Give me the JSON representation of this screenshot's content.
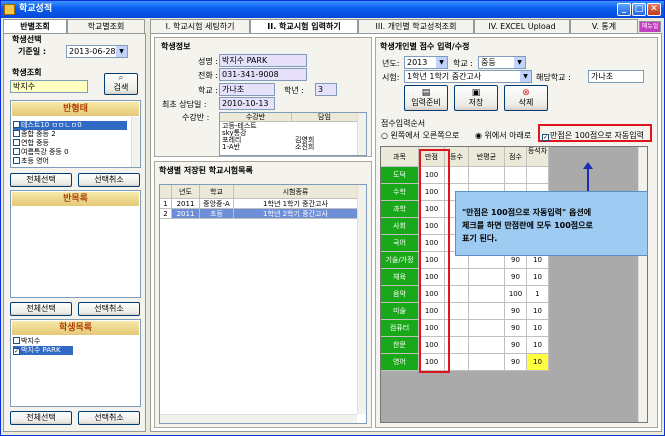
{
  "window": {
    "title": "학교성적",
    "minimize": "_",
    "maximize": "□",
    "close": "✕"
  },
  "left_tabs": [
    {
      "label": "반별조회"
    },
    {
      "label": "학교별조회"
    }
  ],
  "left": {
    "student_select": "학생선택",
    "base_date_label": "기준일 :",
    "base_date": "2013-06-28",
    "student_search": "학생조회",
    "search_value": "박지수",
    "search_button": "검색",
    "class_list": {
      "header": "반형태",
      "items": [
        {
          "label": "테스트10 ㅁㅁㄴㅁ0",
          "checked": false,
          "selected": true
        },
        {
          "label": "종합 중등 2",
          "checked": false,
          "selected": false
        },
        {
          "label": "연합 중등",
          "checked": false,
          "selected": false
        },
        {
          "label": "여름특강 중등 0",
          "checked": false,
          "selected": false
        },
        {
          "label": "초등 영어",
          "checked": false,
          "selected": false
        }
      ],
      "select_all": "전체선택",
      "deselect": "선택취소"
    },
    "class_items": {
      "header": "반목록",
      "select_all": "전체선택",
      "deselect": "선택취소"
    },
    "student_list": {
      "header": "학생목록",
      "items": [
        {
          "label": "박지수",
          "checked": false,
          "selected": false
        },
        {
          "label": "박지수 PARK",
          "checked": true,
          "selected": true
        }
      ],
      "select_all": "전체선택",
      "deselect": "선택취소"
    }
  },
  "main_tabs": [
    {
      "label": "I. 학교시험 세팅하기"
    },
    {
      "label": "II. 학교시험 입력하기"
    },
    {
      "label": "III. 개인별 학교성적조회"
    },
    {
      "label": "IV. EXCEL Upload"
    },
    {
      "label": "V. 통계"
    },
    {
      "label": "매뉴얼"
    }
  ],
  "student_info": {
    "title": "학생정보",
    "name_label": "성명 :",
    "name": "박지수 PARK",
    "phone_label": "전화 :",
    "phone": "031-341-9008",
    "school_label": "학교 :",
    "school": "가나초",
    "grade_label": "학년 :",
    "grade": "3",
    "consult_label": "최초 상담일 :",
    "consult_date": "2010-10-13",
    "classes_label": "수강반 :",
    "classes_header": [
      "수강반",
      "담임"
    ],
    "classes": [
      [
        "고등-테스트",
        ""
      ],
      [
        "sky통강",
        ""
      ],
      [
        "포레리",
        "김영희"
      ],
      [
        "1-A반",
        "소진희"
      ]
    ]
  },
  "saved_exams": {
    "title": "학생별 저장된 학교시험목록",
    "headers": [
      "",
      "년도",
      "학교",
      "시험종류"
    ],
    "rows": [
      [
        "1",
        "2011",
        "중앙중-A",
        "1학년 1학기 중간고사"
      ],
      [
        "2",
        "2011",
        "초등",
        "1학년 2학기 중간고사"
      ]
    ]
  },
  "score_entry": {
    "title": "학생개인별 점수 입력/수정",
    "year_label": "년도:",
    "year": "2013",
    "school_level_label": "학교 :",
    "school_level": "중등",
    "exam_label": "시험:",
    "exam": "1학년 1학기 중간고사",
    "school_label": "해당학교 :",
    "school": "가나초",
    "prepare_button": "입력준비",
    "save_button": "저장",
    "delete_button": "삭제",
    "order_label": "점수입력순서",
    "order_lr": "왼쪽에서 오른쪽으로",
    "order_tb": "위에서 아래로",
    "auto_max_label": "만점은 100점으로 자동입력",
    "headers": [
      "과목",
      "만점",
      "등수",
      "반평균",
      "점수",
      "등석차"
    ],
    "rows": [
      [
        "도덕",
        "100",
        "",
        "",
        "",
        ""
      ],
      [
        "수학",
        "100",
        "",
        "",
        "",
        ""
      ],
      [
        "과학",
        "100",
        "",
        "",
        "",
        ""
      ],
      [
        "사회",
        "100",
        "",
        "",
        "",
        ""
      ],
      [
        "국어",
        "100",
        "",
        "",
        "70",
        "10"
      ],
      [
        "기술/가정",
        "100",
        "",
        "",
        "90",
        "10"
      ],
      [
        "체육",
        "100",
        "",
        "",
        "90",
        "10"
      ],
      [
        "음악",
        "100",
        "",
        "",
        "100",
        "1"
      ],
      [
        "미술",
        "100",
        "",
        "",
        "90",
        "10"
      ],
      [
        "컴퓨터",
        "100",
        "",
        "",
        "90",
        "10"
      ],
      [
        "한문",
        "100",
        "",
        "",
        "90",
        "10"
      ],
      [
        "영어",
        "100",
        "",
        "",
        "90",
        "10"
      ]
    ]
  },
  "callout": {
    "line1": "\"만점은 100점으로 자동입력\" 옵션에",
    "line2": "체크를 하면 만점란에 모두 100점으로",
    "line3": "표기 된다."
  },
  "colors": {
    "accent": "#0a5ff0",
    "subject": "#19a819",
    "highlight": "#e0141e",
    "callout": "#9ecbf2"
  }
}
